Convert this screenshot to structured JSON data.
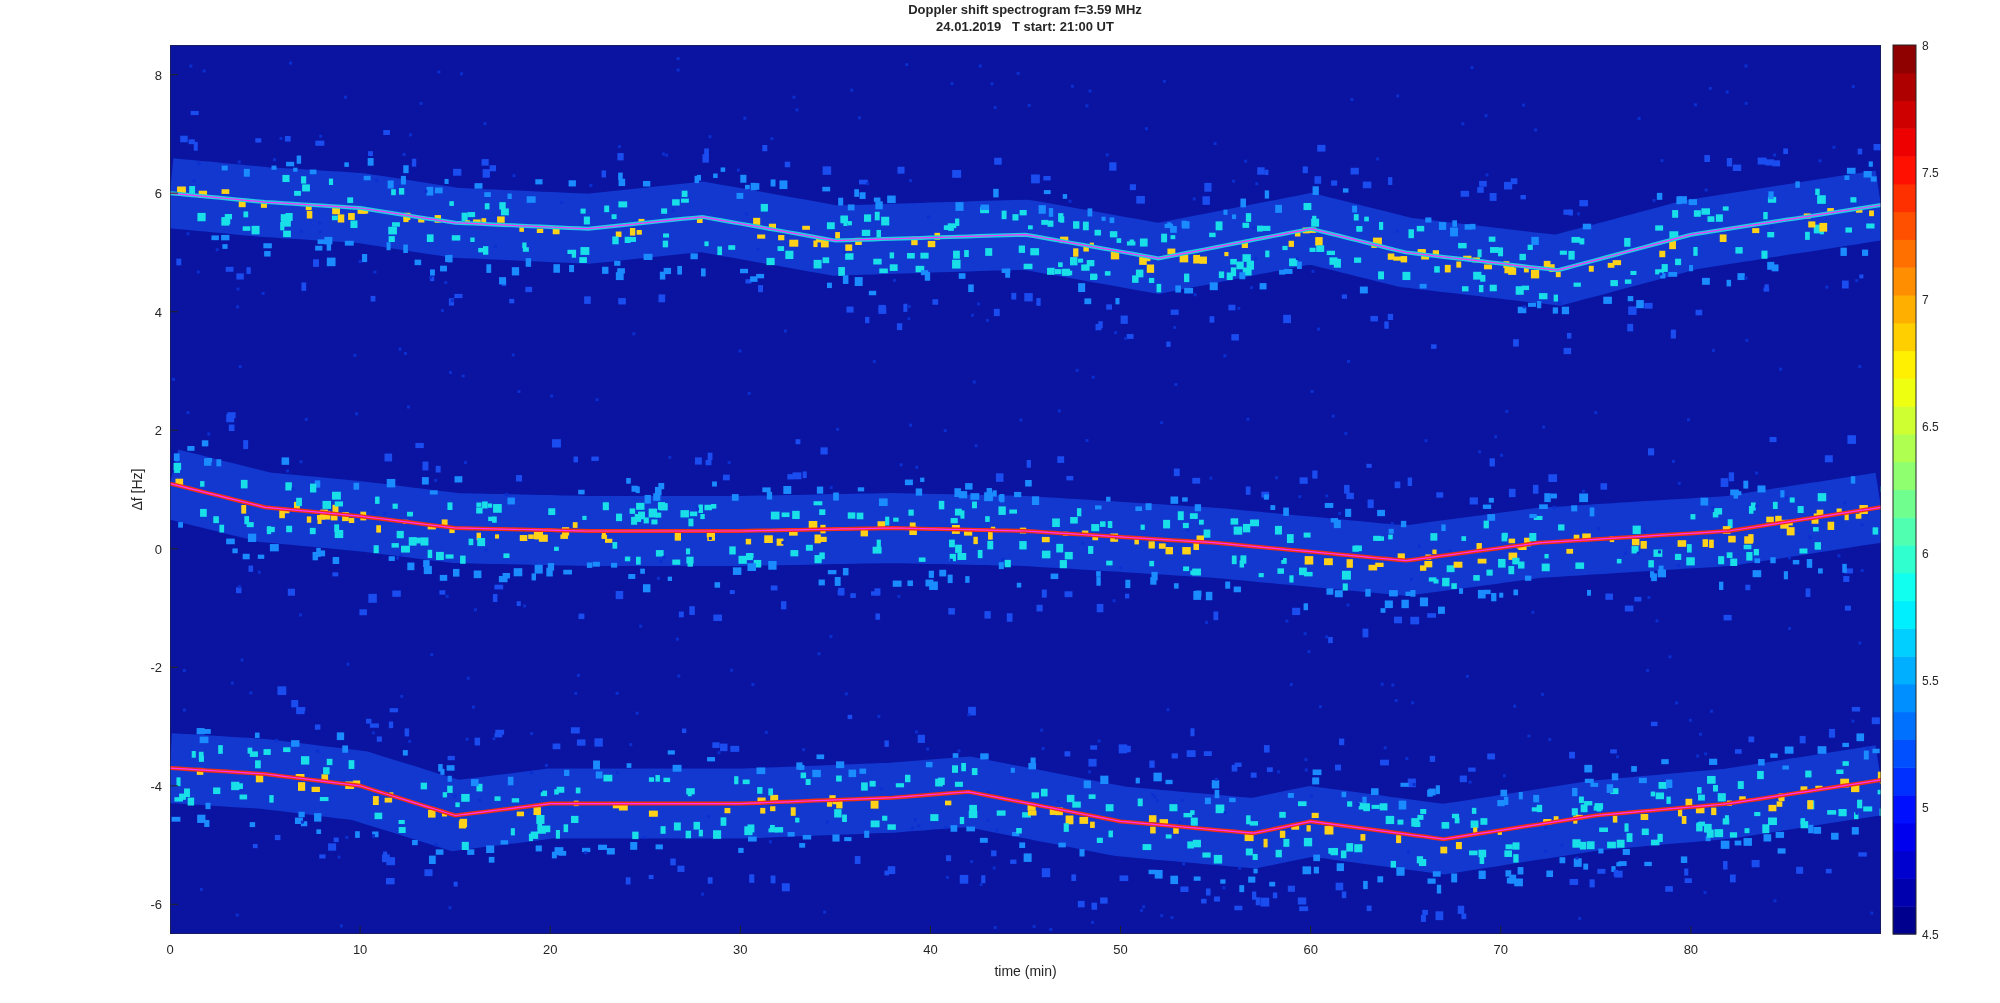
{
  "figure": {
    "title_lines": [
      "Doppler shift spectrogram f=3.59 MHz",
      "24.01.2019   T start: 21:00 UT"
    ],
    "axes": {
      "ylabel": "Δf [Hz]",
      "xlabel": "time (min)",
      "yticks": [
        "8",
        "6",
        "4",
        "2",
        "0",
        "-2",
        "-4",
        "-6"
      ],
      "xticks": [
        "0",
        "10",
        "20",
        "30",
        "40",
        "50",
        "60",
        "70",
        "80"
      ]
    },
    "colorbar": {
      "ticks": [
        "8",
        "7.5",
        "7",
        "6.5",
        "6",
        "5.5",
        "5",
        "4.5"
      ]
    }
  }
}
